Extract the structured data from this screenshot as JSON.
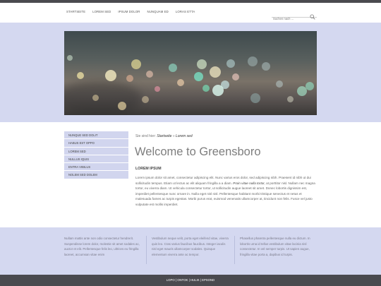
{
  "nav": {
    "items": [
      "STARTSEITE",
      "LOREM SED",
      "IPSUM DOLOR",
      "NUNQUAM ED",
      "LORAS ETTA"
    ]
  },
  "search": {
    "placeholder": "Suchen nach ...",
    "icon": "search-icon"
  },
  "sidebar": {
    "items": [
      "NUNQUE SED DOLIT",
      "HABUS EST OPPO",
      "LOREM SED",
      "NULLUS IQUIS",
      "ENTRA VIBILUS",
      "NOLEM SED DOLEM"
    ]
  },
  "breadcrumb": {
    "prefix": "Sie sind hier:",
    "home": "Startseite",
    "separator": "»",
    "current": "Lorem sed"
  },
  "main": {
    "title": "Welcome to Greensboro",
    "subhead": "LOREM IPSUM",
    "body_pre": "Lorem ipsum dolor sit amet, consectetur adipiscing elit. Nunc varius eros dolor, sed adipiscing nibh. Praesent id nibh ut dui sollicitudin tempus. Etiam ut lectus ac elit aliquam fringilla a a diam.",
    "body_em": "Proin vitae nulla tortor,",
    "body_post": "at porttitor nisl. Nullam nec magna tortor, eu viverra diam. Ut vehicula consectetur tortor, ut sollicitudin augue laoreet sit amet. Donec lobortis dignissim est, imperdiet pellentesque nunc ornare in. Nulla eget nisl nisl. Pellentesque habitant morbi tristique senectus et netus et malesuada fames ac turpis egestas. Morbi purus erat, euismod venenatis ullamcorper at, tincidunt non felis. Fusce vel justo vulputate est mollis imperdiet."
  },
  "footer": {
    "columns": [
      "Nullam mattis ante non odio consectetur hendrerit. Suspendisse lorem dolor, molestie sit amet sodales ac, auctor et elit. Pellentesque felis leo, ultrices eu fringilla laoreet, accumsan vitae enim",
      "Vestibulum neque velit, porta eget eleifend vitae, viverra quis leo. Cras varius faucibus faucibus. Integer iaculis nisl eget mauris ullamcorper sodales. Quisque elementum viverra ante ac tempor.",
      "Phasellus pharetra pellentesque nulla eu dictum. In lobortis urna id tellus vestibulum vitae lacinia nisl consectetur. In vel semper turpis. Ut sapien augue, fringilla vitae porta a, dapibus id turpis."
    ]
  },
  "bottom": {
    "links": "LOPO | ONTOK | HULIK | EPSOND"
  },
  "colors": {
    "accent_band": "#d4d8f0",
    "sidebar_item": "#d1d5ee",
    "dark_bar": "#4a4a4f"
  }
}
